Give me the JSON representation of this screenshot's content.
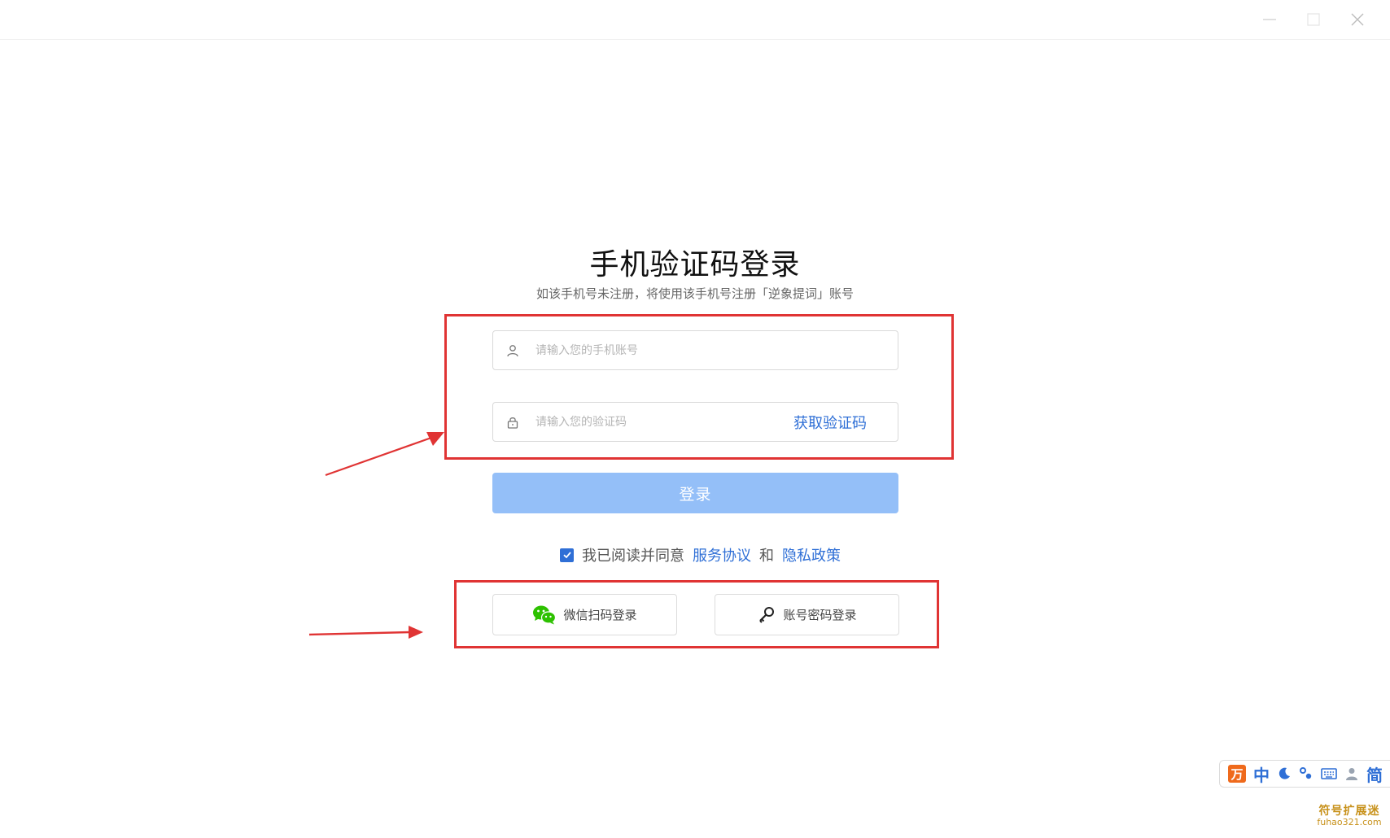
{
  "window": {
    "minimize_icon": "minimize-icon",
    "maximize_icon": "maximize-icon",
    "close_icon": "close-icon"
  },
  "login": {
    "title": "手机验证码登录",
    "subtitle": "如该手机号未注册，将使用该手机号注册「逆象提词」账号",
    "phone_placeholder": "请输入您的手机账号",
    "code_placeholder": "请输入您的验证码",
    "get_code_label": "获取验证码",
    "submit_label": "登录",
    "agreement": {
      "checked": true,
      "prefix": "我已阅读并同意",
      "terms_label": "服务协议",
      "and_label": "和",
      "privacy_label": "隐私政策"
    },
    "alt": {
      "wechat_label": "微信扫码登录",
      "account_label": "账号密码登录"
    }
  },
  "ime": {
    "mode_label": "中",
    "charset_label": "简"
  },
  "watermark": {
    "line1": "符号扩展迷",
    "line2": "fuhao321.com"
  },
  "colors": {
    "accent": "#2f6fd6",
    "button_disabled": "#94bff8",
    "annotation": "#e03434",
    "wechat": "#2dc100"
  }
}
